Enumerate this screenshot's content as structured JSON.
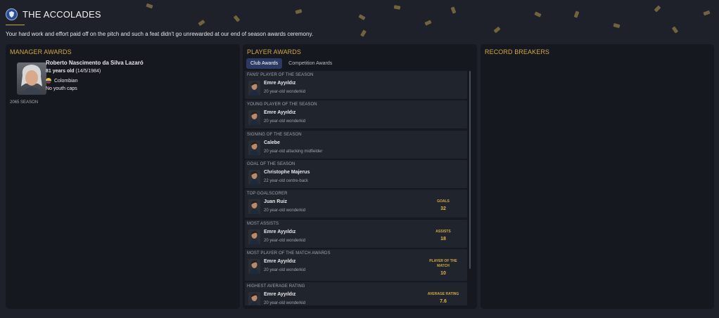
{
  "header": {
    "title": "THE ACCOLADES",
    "subtitle": "Your hard work and effort paid off on the pitch and such a feat didn't go unrewarded at our end of season awards ceremony."
  },
  "manager_awards": {
    "title": "MANAGER AWARDS",
    "name": "Roberto Nascimento da Silva Lazaró",
    "age": "81 years old",
    "dob": "(14/5/1984)",
    "nationality": "Colombian",
    "youth_caps": "No youth caps",
    "season": "2065 SEASON"
  },
  "player_awards": {
    "title": "PLAYER AWARDS",
    "tabs": [
      "Club Awards",
      "Competition Awards"
    ],
    "active_tab": "Club Awards",
    "awards": [
      {
        "category": "FANS' PLAYER OF THE SEASON",
        "player": "Emre Ayyıldız",
        "desc": "20 year-old wonderkid"
      },
      {
        "category": "YOUNG PLAYER OF THE SEASON",
        "player": "Emre Ayyıldız",
        "desc": "20 year-old wonderkid"
      },
      {
        "category": "SIGNING OF THE SEASON",
        "player": "Calebe",
        "desc": "20 year-old attacking midfielder"
      },
      {
        "category": "GOAL OF THE SEASON",
        "player": "Christophe Majerus",
        "desc": "22 year-old centre-back"
      },
      {
        "category": "TOP GOALSCORER",
        "player": "Juan Ruiz",
        "desc": "20 year-old wonderkid",
        "stat_label": "GOALS",
        "stat_value": "32"
      },
      {
        "category": "MOST ASSISTS",
        "player": "Emre Ayyıldız",
        "desc": "20 year-old wonderkid",
        "stat_label": "ASSISTS",
        "stat_value": "18"
      },
      {
        "category": "MOST PLAYER OF THE MATCH AWARDS",
        "player": "Emre Ayyıldız",
        "desc": "20 year-old wonderkid",
        "stat_label": "PLAYER OF THE MATCH",
        "stat_value": "10"
      },
      {
        "category": "HIGHEST AVERAGE RATING",
        "player": "Emre Ayyıldız",
        "desc": "20 year-old wonderkid",
        "stat_label": "AVERAGE RATING",
        "stat_value": "7.6"
      }
    ]
  },
  "record_breakers": {
    "title": "RECORD BREAKERS"
  },
  "icons": {
    "club_badge": "club-crest-icon",
    "flag": "colombia-flag-icon"
  },
  "colors": {
    "accent": "#d6a93f",
    "panel": "#15181e",
    "background": "#1e2129",
    "active_tab": "#2b3a63"
  }
}
